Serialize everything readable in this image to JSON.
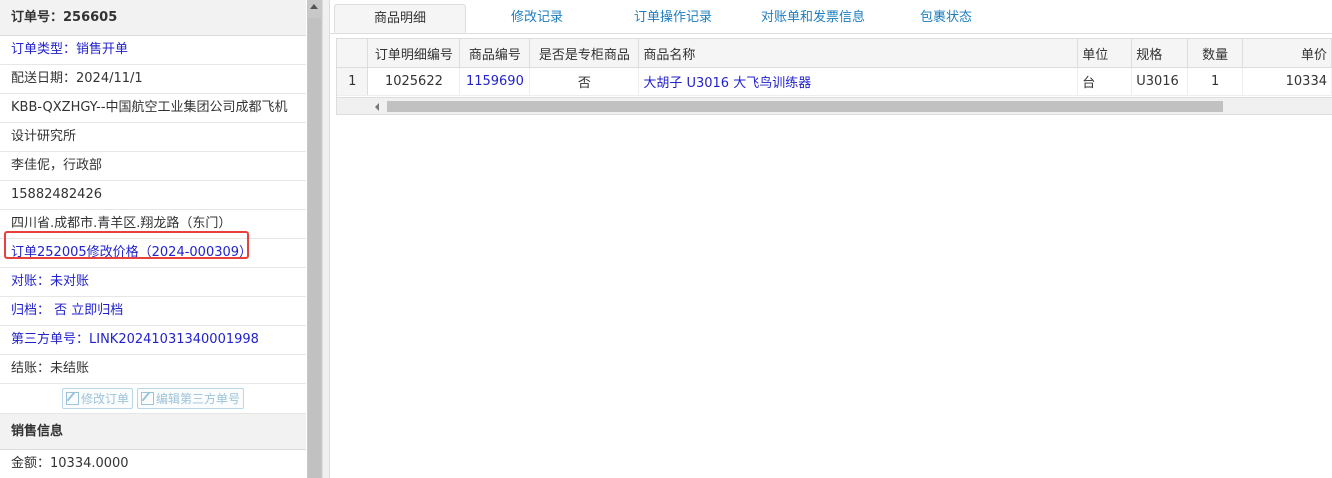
{
  "left_panel": {
    "order_title": "订单号：256605",
    "rows": [
      {
        "text": "订单类型：销售开单",
        "color": "blue"
      },
      {
        "text": "配送日期：2024/11/1",
        "color": "dark"
      },
      {
        "text": "KBB-QXZHGY--中国航空工业集团公司成都飞机",
        "color": "dark"
      },
      {
        "text": "设计研究所",
        "color": "dark"
      },
      {
        "text": "李佳伲，行政部",
        "color": "dark"
      },
      {
        "text": "15882482426",
        "color": "dark"
      },
      {
        "text": "四川省.成都市.青羊区.翔龙路（东门）",
        "color": "dark"
      },
      {
        "text": "订单252005修改价格（2024-000309）",
        "color": "blue"
      },
      {
        "text": "对账：未对账",
        "color": "blue"
      },
      {
        "text": "归档： 否 立即归档",
        "color": "blue"
      },
      {
        "text": "第三方单号：LINK20241031340001998",
        "color": "blue"
      },
      {
        "text": "结账：未结账",
        "color": "dark"
      }
    ],
    "buttons": {
      "edit_order": "修改订单",
      "edit_third": "编辑第三方单号"
    },
    "sales_header": "销售信息",
    "amount": "金额：10334.0000"
  },
  "tabs": [
    {
      "label": "商品明细",
      "active": true
    },
    {
      "label": "修改记录",
      "active": false
    },
    {
      "label": "订单操作记录",
      "active": false
    },
    {
      "label": "对账单和发票信息",
      "active": false
    },
    {
      "label": "包裹状态",
      "active": false
    }
  ],
  "table": {
    "headers": [
      "",
      "订单明细编号",
      "商品编号",
      "是否是专柜商品",
      "商品名称",
      "单位",
      "规格",
      "数量",
      "单价"
    ],
    "rows": [
      [
        "1",
        "1025622",
        "1159690",
        "否",
        "大胡子 U3016 大飞鸟训练器",
        "台",
        "U3016",
        "1",
        "10334"
      ]
    ]
  },
  "colors": {
    "highlight_border": "#e8403a",
    "link_blue": "#2222cc",
    "tab_blue": "#1e7dbf"
  }
}
